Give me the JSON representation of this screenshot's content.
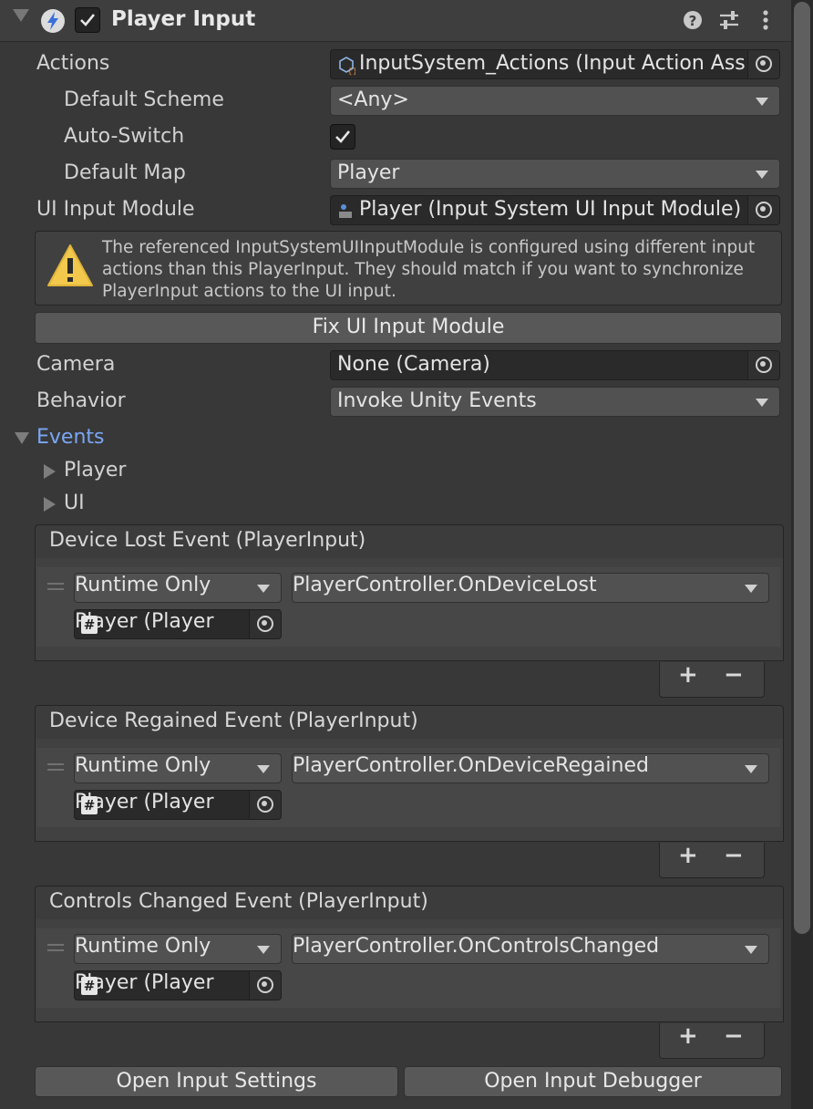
{
  "component": {
    "title": "Player Input",
    "enabled": true
  },
  "fields": {
    "actions_label": "Actions",
    "actions_value": "InputSystem_Actions (Input Action Ass",
    "default_scheme_label": "Default Scheme",
    "default_scheme_value": "<Any>",
    "auto_switch_label": "Auto-Switch",
    "auto_switch_checked": true,
    "default_map_label": "Default Map",
    "default_map_value": "Player",
    "ui_input_module_label": "UI Input Module",
    "ui_input_module_value": "Player (Input System UI Input Module)",
    "camera_label": "Camera",
    "camera_value": "None (Camera)",
    "behavior_label": "Behavior",
    "behavior_value": "Invoke Unity Events"
  },
  "warning": {
    "text": "The referenced InputSystemUIInputModule is configured using different input actions than this PlayerInput. They should match if you want to synchronize PlayerInput actions to the UI input."
  },
  "buttons": {
    "fix_ui": "Fix UI Input Module",
    "open_settings": "Open Input Settings",
    "open_debugger": "Open Input Debugger"
  },
  "events": {
    "label": "Events",
    "groups": [
      "Player",
      "UI"
    ],
    "unity_events": [
      {
        "title": "Device Lost Event (PlayerInput)",
        "mode": "Runtime Only",
        "function": "PlayerController.OnDeviceLost",
        "target": "Player (Player"
      },
      {
        "title": "Device Regained Event (PlayerInput)",
        "mode": "Runtime Only",
        "function": "PlayerController.OnDeviceRegained",
        "target": "Player (Player"
      },
      {
        "title": "Controls Changed Event (PlayerInput)",
        "mode": "Runtime Only",
        "function": "PlayerController.OnControlsChanged",
        "target": "Player (Player"
      }
    ],
    "add_symbol": "+",
    "remove_symbol": "−"
  },
  "icons": {
    "fold": "fold-down-icon",
    "component": "lightning-icon",
    "help": "help-icon",
    "presets": "sliders-icon",
    "menu": "kebab-menu-icon",
    "asset": "input-actions-asset-icon",
    "module": "ui-input-module-icon",
    "warning": "warning-icon",
    "object_picker": "object-picker-icon",
    "script": "script-hash-icon"
  },
  "colors": {
    "accent_link": "#7aa7f5",
    "warning": "#f2c94c",
    "background": "#383838"
  }
}
